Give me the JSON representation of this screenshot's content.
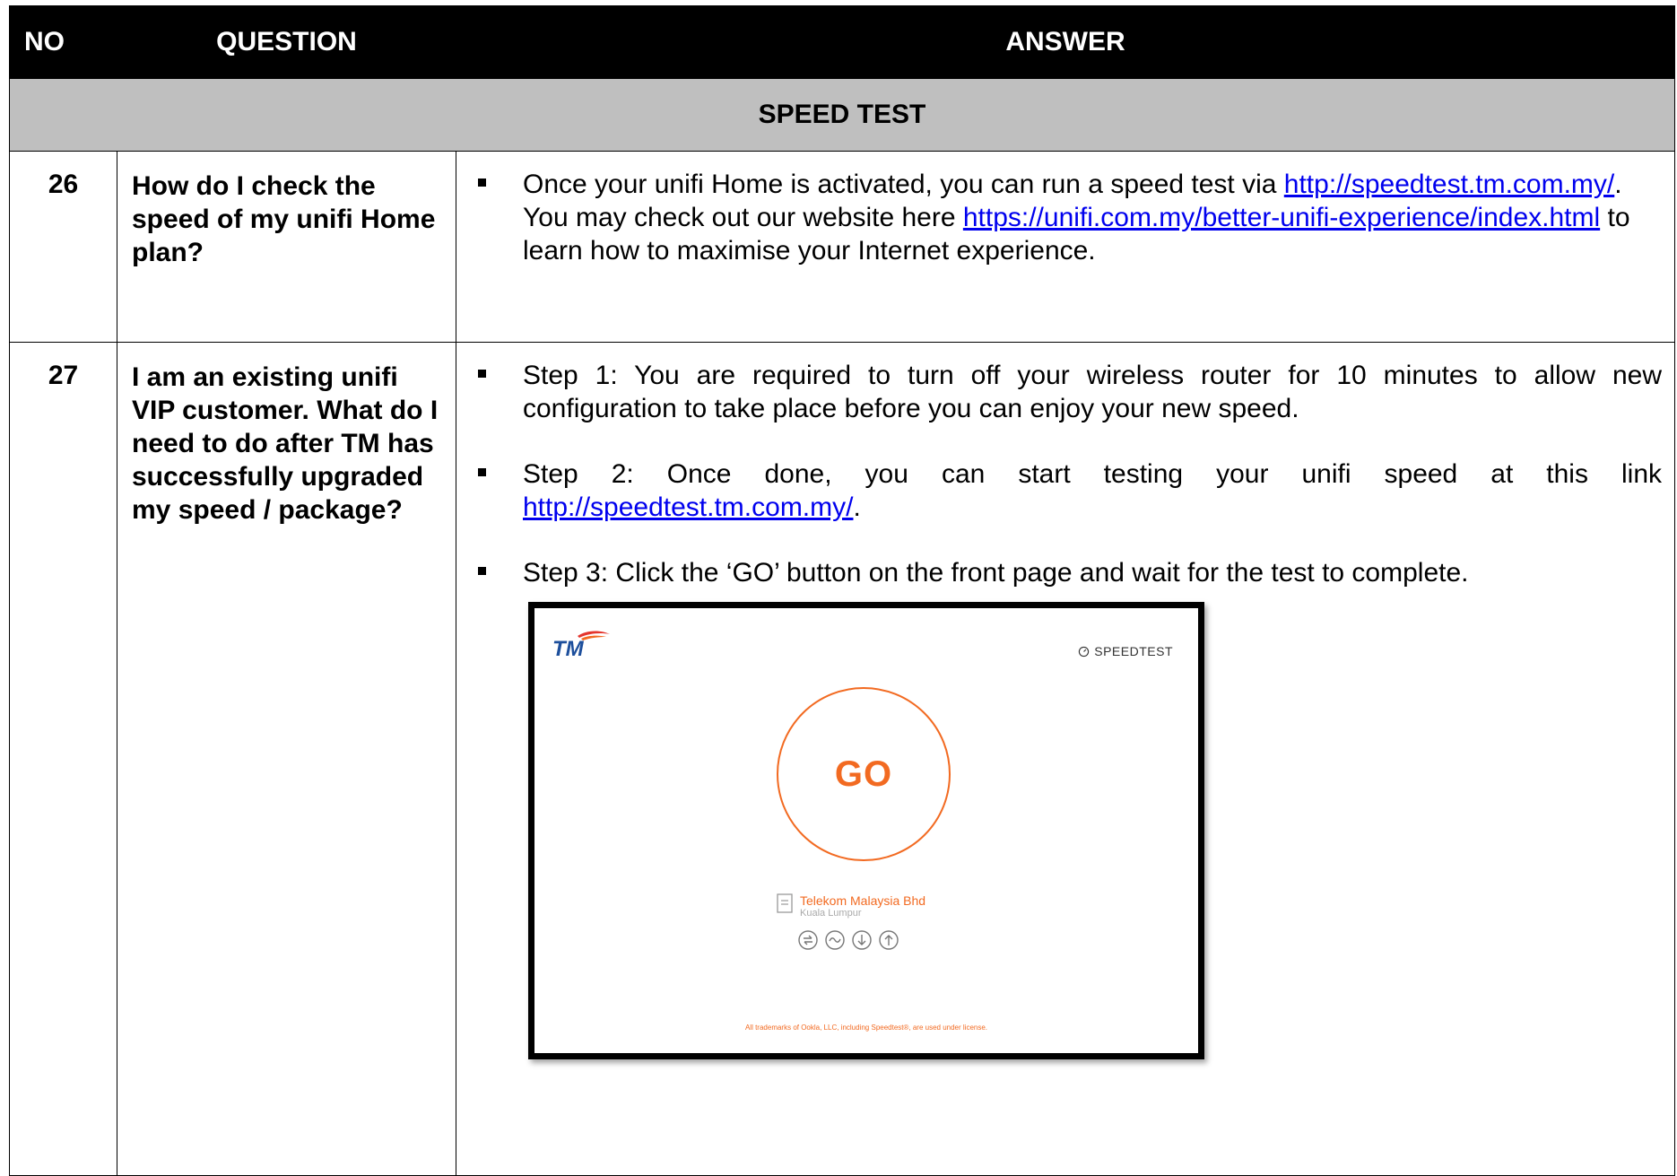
{
  "header": {
    "no": "NO",
    "question": "QUESTION",
    "answer": "ANSWER"
  },
  "section": {
    "title": "SPEED TEST"
  },
  "rows": [
    {
      "no": "26",
      "question": "How do I check the speed of my unifi Home plan?",
      "answer": {
        "part1": "Once your unifi Home is activated, you can run a speed test via ",
        "link1": "http://speedtest.tm.com.my/",
        "part2": ". You may check out our website here ",
        "link2": "https://unifi.com.my/better-unifi-experience/index.html",
        "part3": " to learn how to maximise your Internet experience."
      }
    },
    {
      "no": "27",
      "question": "I am an existing unifi VIP customer. What do I need to do after TM has successfully upgraded my speed / package?",
      "steps": [
        {
          "text": "Step 1: You are required to turn off your wireless router for 10 minutes to allow new configuration to take place before you can enjoy your new speed."
        },
        {
          "text": "Step 2: Once done, you can start testing your unifi speed at this link ",
          "link": "http://speedtest.tm.com.my/",
          "after": "."
        },
        {
          "text": "Step 3: Click the ‘GO’ button on the front page and wait for the test to complete."
        }
      ],
      "screenshot": {
        "logo": "TM",
        "brand": "SPEEDTEST",
        "go_label": "GO",
        "server_name": "Telekom Malaysia Bhd",
        "server_location": "Kuala Lumpur",
        "metric_icons": [
          "ping-icon",
          "jitter-icon",
          "download-icon",
          "upload-icon"
        ],
        "footnote": "All trademarks of Ookla, LLC, including Speedtest®, are used under license.",
        "accent_color": "#f26a21"
      }
    }
  ]
}
